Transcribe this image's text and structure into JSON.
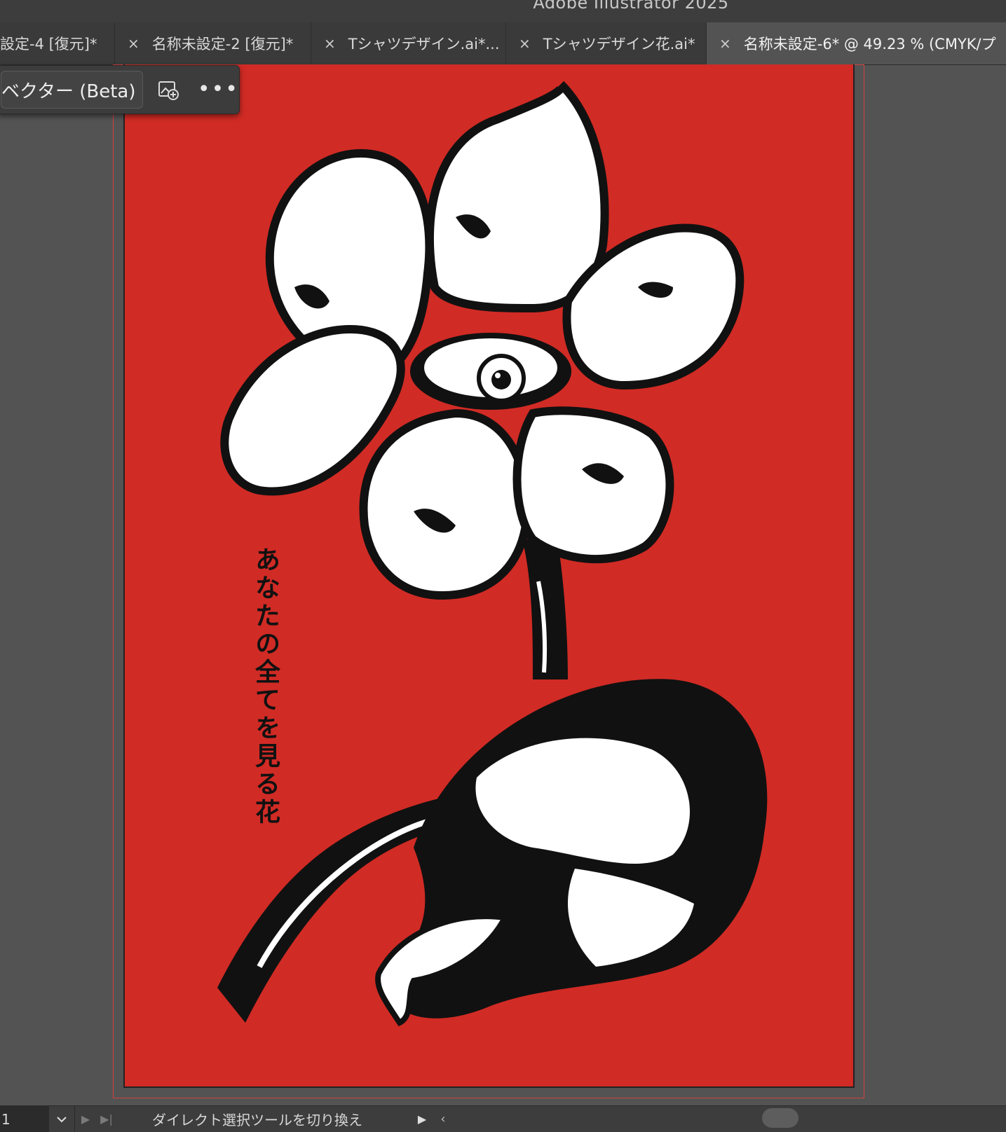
{
  "window": {
    "app_title": "Adobe Illustrator 2025"
  },
  "tabs": [
    {
      "label": "設定-4 [復元]*",
      "closable": false
    },
    {
      "label": "名称未設定-2 [復元]*",
      "closable": true
    },
    {
      "label": "Tシャツデザイン.ai*...",
      "closable": true
    },
    {
      "label": "Tシャツデザイン花.ai*",
      "closable": true
    },
    {
      "label": "名称未設定-6* @ 49.23 % (CMYK/プ",
      "closable": true,
      "active": true
    }
  ],
  "tab_close_glyph": "×",
  "panel": {
    "vectorize_label": "ベクター (Beta)",
    "add_icon": "image-add-icon",
    "more_label": "•••"
  },
  "artwork": {
    "caption": "あなたの全てを見る花",
    "background_color": "#d12b25",
    "ink_color": "#111111",
    "paper_color": "#ffffff"
  },
  "statusbar": {
    "zoom_value": "1",
    "tool_status": "ダイレクト選択ツールを切り換え",
    "left_arrow": "‹"
  }
}
